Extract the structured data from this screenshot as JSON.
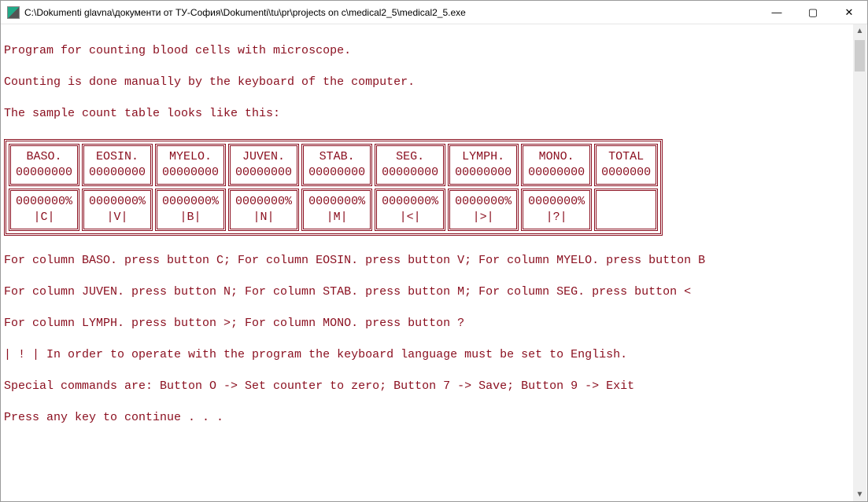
{
  "window": {
    "title": "C:\\Dokumenti glavna\\документи от ТУ-София\\Dokumenti\\tu\\pr\\projects on c\\medical2_5\\medical2_5.exe"
  },
  "intro": {
    "l1": "Program for counting blood cells with microscope.",
    "l2": "Counting is done manually by the keyboard of the computer.",
    "l3": "The sample count table looks like this:"
  },
  "table": {
    "headers": [
      {
        "name": "BASO.",
        "count": "00000000"
      },
      {
        "name": "EOSIN.",
        "count": "00000000"
      },
      {
        "name": "MYELO.",
        "count": "00000000"
      },
      {
        "name": "JUVEN.",
        "count": "00000000"
      },
      {
        "name": "STAB.",
        "count": "00000000"
      },
      {
        "name": "SEG.",
        "count": "00000000"
      },
      {
        "name": "LYMPH.",
        "count": "00000000"
      },
      {
        "name": "MONO.",
        "count": "00000000"
      },
      {
        "name": "TOTAL",
        "count": "0000000"
      }
    ],
    "percents": [
      {
        "pct": "0000000%",
        "key": "|C|"
      },
      {
        "pct": "0000000%",
        "key": "|V|"
      },
      {
        "pct": "0000000%",
        "key": "|B|"
      },
      {
        "pct": "0000000%",
        "key": "|N|"
      },
      {
        "pct": "0000000%",
        "key": "|M|"
      },
      {
        "pct": "0000000%",
        "key": "|<|"
      },
      {
        "pct": "0000000%",
        "key": "|>|"
      },
      {
        "pct": "0000000%",
        "key": "|?|"
      }
    ]
  },
  "instructions": {
    "l1": "For column BASO. press button C; For column EOSIN. press button V; For column MYELO. press button B",
    "l2": "For column JUVEN. press button N; For column STAB. press button M; For column SEG. press button <",
    "l3": "For column LYMPH. press button >; For column MONO. press button ?",
    "l4": "| ! | In order to operate with the program the keyboard language must be set to English.",
    "l5": "Special commands are: Button O -> Set counter to zero; Button 7 -> Save; Button 9 -> Exit",
    "l6": "Press any key to continue . . ."
  }
}
